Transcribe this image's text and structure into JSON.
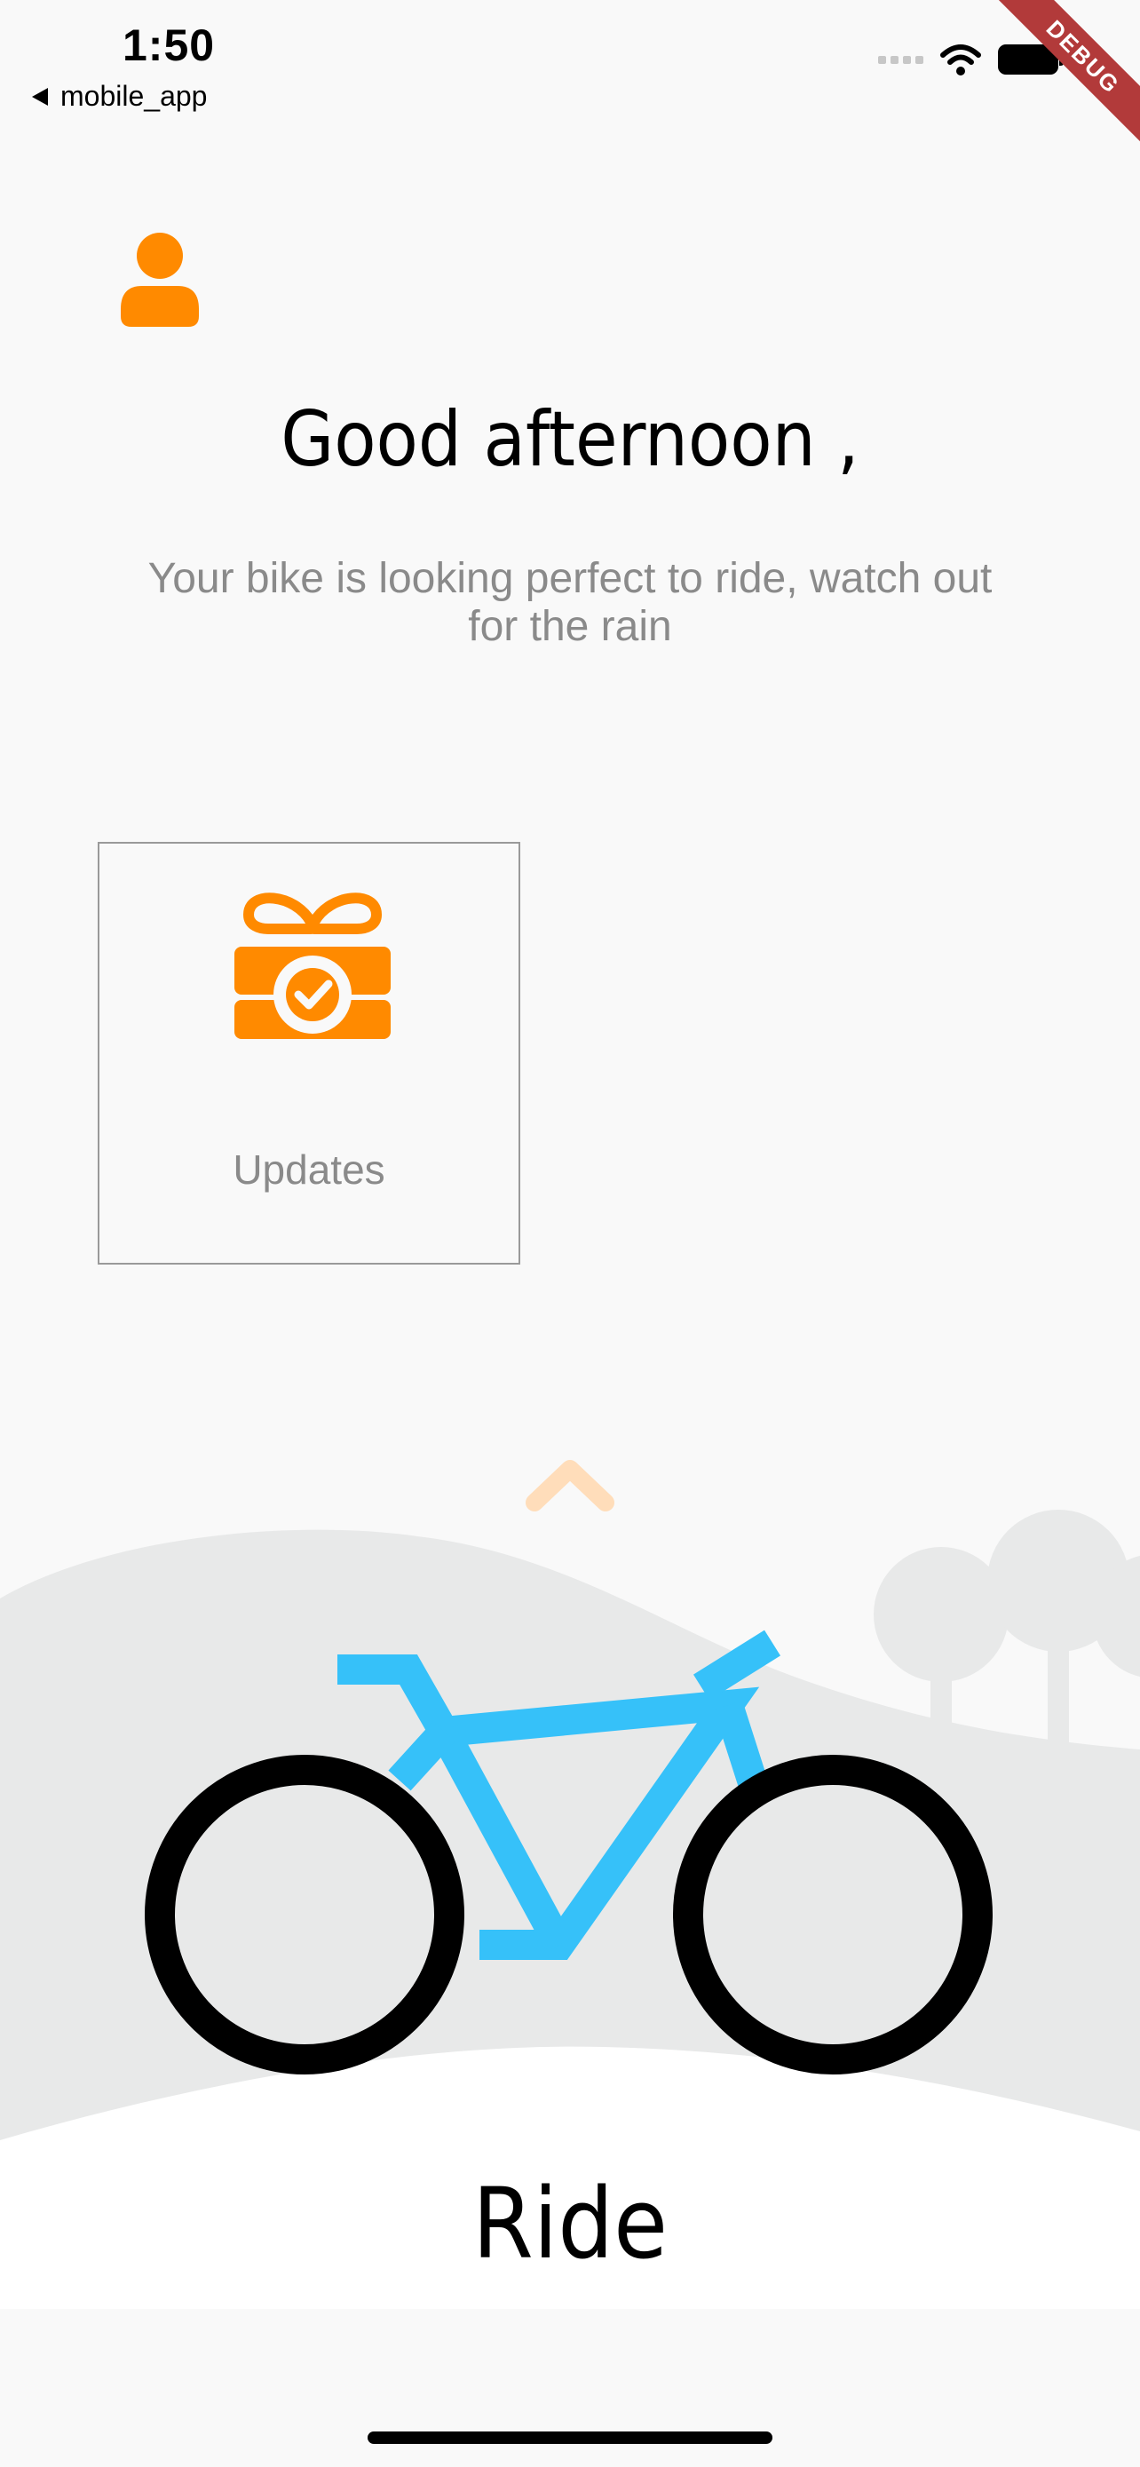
{
  "status_bar": {
    "time": "1:50",
    "back_app": "mobile_app",
    "icons": [
      "signal-icon",
      "wifi-icon",
      "battery-icon"
    ]
  },
  "debug_banner": "DEBUG",
  "header": {
    "profile_icon": "person-icon",
    "greeting": "Good afternoon ,",
    "subtitle": "Your bike is looking perfect to ride, watch out for the rain"
  },
  "cards": [
    {
      "icon": "gift-check-icon",
      "label": "Updates"
    }
  ],
  "scene": {
    "chevron_icon": "chevron-up-icon",
    "bike_icon": "bicycle-icon",
    "trees_icon": "trees-icon"
  },
  "ride_label": "Ride",
  "colors": {
    "accent": "#FF8A00",
    "bike_frame": "#36C1F9",
    "hills": "#E8E9E9",
    "background": "#F9F9F9",
    "subtext": "#8A8A8A"
  }
}
